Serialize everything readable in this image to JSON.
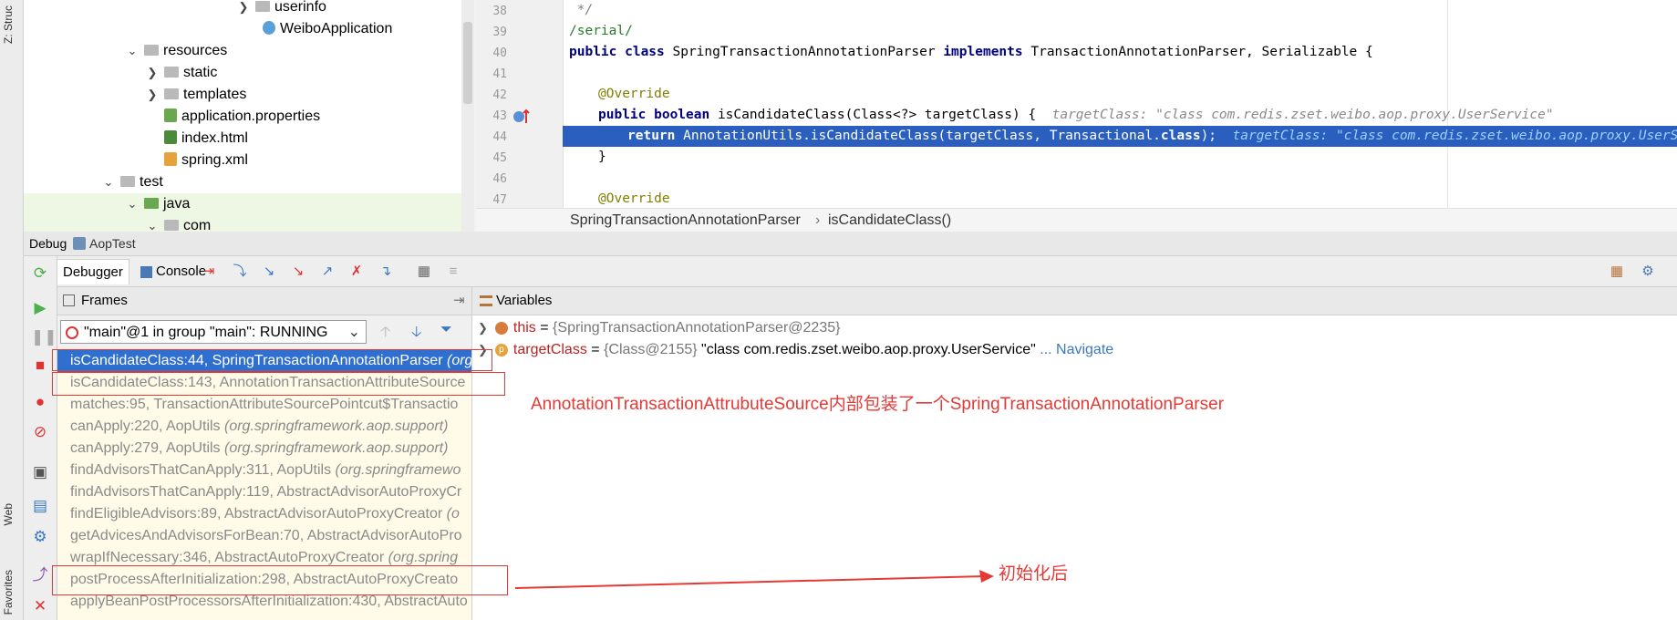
{
  "left_strip": {
    "tab_structure": "Z: Struc",
    "tab_web": "Web",
    "tab_favorites": "Favorites"
  },
  "project_tree": [
    {
      "label": "userinfo",
      "type": "folder",
      "expanded": false
    },
    {
      "label": "WeiboApplication",
      "type": "spring-class"
    },
    {
      "label": "resources",
      "type": "folder",
      "expanded": true
    },
    {
      "label": "static",
      "type": "folder",
      "expanded": false
    },
    {
      "label": "templates",
      "type": "folder",
      "expanded": false
    },
    {
      "label": "application.properties",
      "type": "properties"
    },
    {
      "label": "index.html",
      "type": "html"
    },
    {
      "label": "spring.xml",
      "type": "xml"
    },
    {
      "label": "test",
      "type": "folder",
      "expanded": true
    },
    {
      "label": "java",
      "type": "folder-green",
      "expanded": true
    },
    {
      "label": "com",
      "type": "folder",
      "expanded": true
    }
  ],
  "editor": {
    "lines": [
      {
        "num": "38",
        "text": " */"
      },
      {
        "num": "39",
        "text": "/serial/"
      },
      {
        "num": "40",
        "kw1": "public class",
        "name": " SpringTransactionAnnotationParser ",
        "kw2": "implements",
        "rest": " TransactionAnnotationParser, Serializable {"
      },
      {
        "num": "41"
      },
      {
        "num": "42",
        "annotation": "@Override"
      },
      {
        "num": "43",
        "kw1": "public boolean",
        "name": " isCandidateClass(Class<?> targetClass) {",
        "debug": "targetClass: \"class com.redis.zset.weibo.aop.proxy.UserService\""
      },
      {
        "num": "44",
        "kw1": "return",
        "name": " AnnotationUtils.isCandidateClass(targetClass, Transactional.",
        "kw2": "class",
        "rest": ");",
        "debug": "targetClass: \"class com.redis.zset.weibo.aop.proxy.UserService\""
      },
      {
        "num": "45",
        "text": "}"
      },
      {
        "num": "46"
      },
      {
        "num": "47",
        "annotation": "@Override"
      }
    ],
    "breadcrumb": {
      "class_name": "SpringTransactionAnnotationParser",
      "separator": "›",
      "method": "isCandidateClass()"
    }
  },
  "debug_panel": {
    "title": "Debug",
    "run_config": "AopTest",
    "tabs": {
      "debugger": "Debugger",
      "console": "Console"
    },
    "frames_title": "Frames",
    "variables_title": "Variables",
    "thread": "\"main\"@1 in group \"main\": RUNNING",
    "frames": [
      {
        "method": "isCandidateClass:44, SpringTransactionAnnotationParser",
        "pkg": "(org",
        "selected": true
      },
      {
        "method": "isCandidateClass:143, AnnotationTransactionAttributeSource",
        "pkg": ""
      },
      {
        "method": "matches:95, TransactionAttributeSourcePointcut$Transactio",
        "pkg": ""
      },
      {
        "method": "canApply:220, AopUtils",
        "pkg": "(org.springframework.aop.support)"
      },
      {
        "method": "canApply:279, AopUtils",
        "pkg": "(org.springframework.aop.support)"
      },
      {
        "method": "findAdvisorsThatCanApply:311, AopUtils",
        "pkg": "(org.springframewo"
      },
      {
        "method": "findAdvisorsThatCanApply:119, AbstractAdvisorAutoProxyCr",
        "pkg": ""
      },
      {
        "method": "findEligibleAdvisors:89, AbstractAdvisorAutoProxyCreator",
        "pkg": "(o"
      },
      {
        "method": "getAdvicesAndAdvisorsForBean:70, AbstractAdvisorAutoPro",
        "pkg": ""
      },
      {
        "method": "wrapIfNecessary:346, AbstractAutoProxyCreator",
        "pkg": "(org.spring"
      },
      {
        "method": "postProcessAfterInitialization:298, AbstractAutoProxyCreato",
        "pkg": ""
      },
      {
        "method": "applyBeanPostProcessorsAfterInitialization:430, AbstractAuto",
        "pkg": ""
      }
    ],
    "variables": [
      {
        "name": "this",
        "eq": " = ",
        "ref": "{SpringTransactionAnnotationParser@2235}",
        "value": "",
        "link": ""
      },
      {
        "name": "targetClass",
        "eq": " = ",
        "ref": "{Class@2155}",
        "value": " \"class com.redis.zset.weibo.aop.proxy.UserService\"",
        "link": " ... Navigate"
      }
    ]
  },
  "annotations": {
    "note1": "AnnotationTransactionAttrubuteSource内部包装了一个SpringTransactionAnnotationParser",
    "note2": "初始化后"
  },
  "colors": {
    "selection": "#2f6fcf",
    "annotation_red": "#e53935",
    "keyword": "#000080"
  }
}
